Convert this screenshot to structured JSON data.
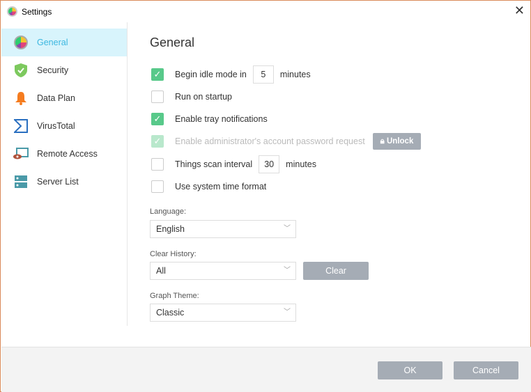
{
  "window": {
    "title": "Settings",
    "close": "✕"
  },
  "sidebar": {
    "items": [
      {
        "label": "General"
      },
      {
        "label": "Security"
      },
      {
        "label": "Data Plan"
      },
      {
        "label": "VirusTotal"
      },
      {
        "label": "Remote Access"
      },
      {
        "label": "Server List"
      }
    ]
  },
  "main": {
    "title": "General",
    "options": [
      {
        "label": "Begin idle mode in",
        "value": "5",
        "suffix": "minutes",
        "checked": true
      },
      {
        "label": "Run on startup",
        "checked": false
      },
      {
        "label": "Enable tray notifications",
        "checked": true
      },
      {
        "label": "Enable administrator's account password request",
        "checked": true,
        "disabled": true,
        "button": "Unlock"
      },
      {
        "label": "Things scan interval",
        "value": "30",
        "suffix": "minutes",
        "checked": false
      },
      {
        "label": "Use system time format",
        "checked": false
      }
    ],
    "language": {
      "label": "Language:",
      "value": "English"
    },
    "history": {
      "label": "Clear History:",
      "value": "All",
      "button": "Clear"
    },
    "theme": {
      "label": "Graph Theme:",
      "value": "Classic"
    }
  },
  "footer": {
    "ok": "OK",
    "cancel": "Cancel"
  }
}
